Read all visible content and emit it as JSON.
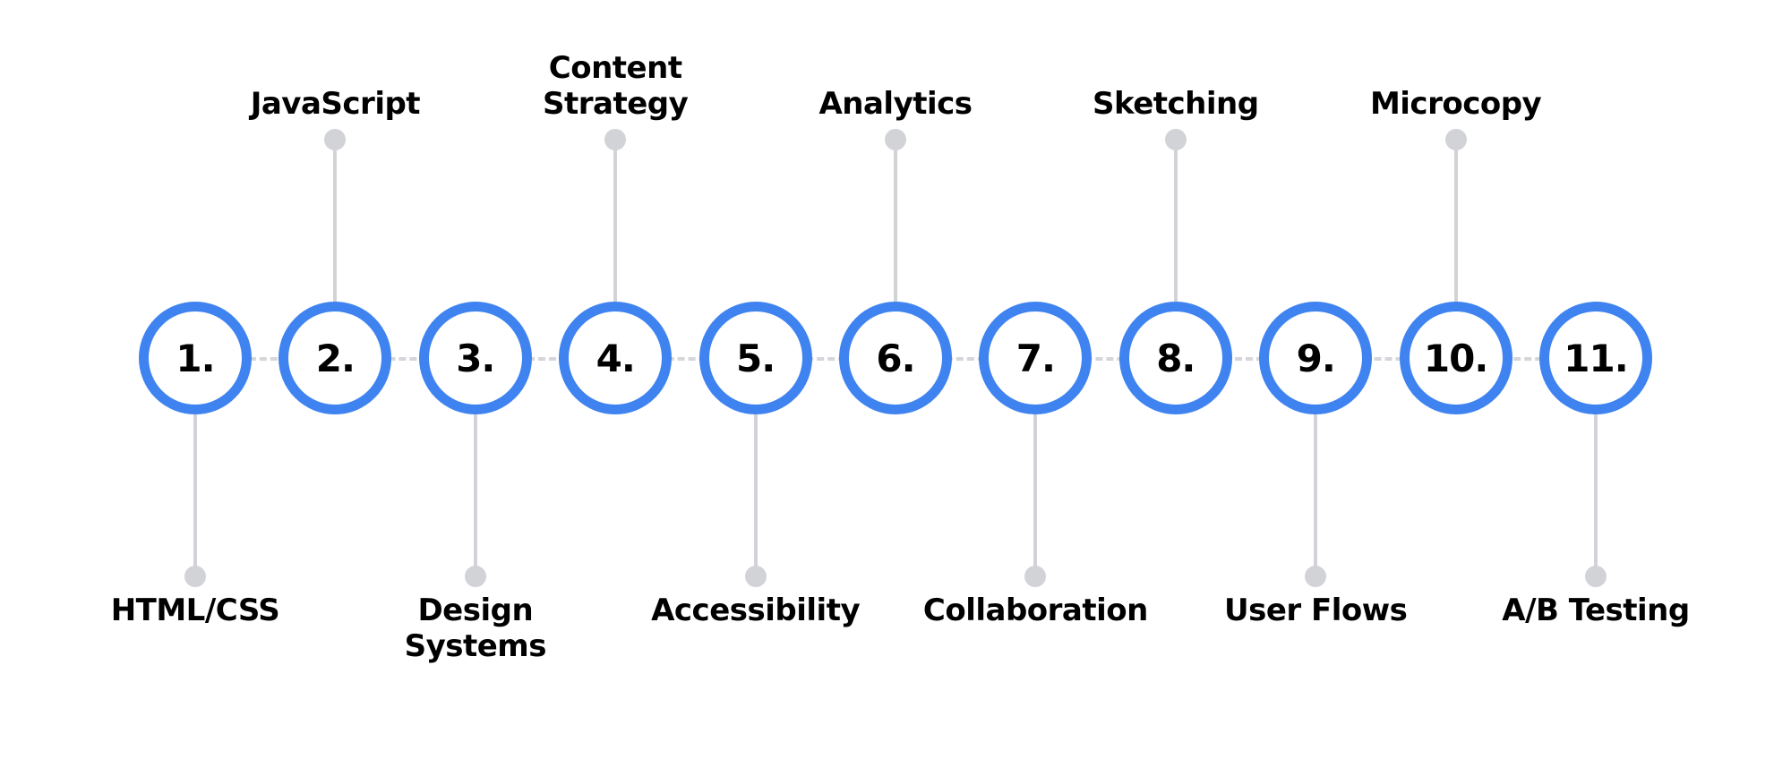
{
  "colors": {
    "ring": "#3f83f0",
    "connector": "#d1d3d7",
    "text": "#000000"
  },
  "steps": [
    {
      "number": "1.",
      "label": "HTML/CSS",
      "side": "bottom"
    },
    {
      "number": "2.",
      "label": "JavaScript",
      "side": "top"
    },
    {
      "number": "3.",
      "label": "Design\nSystems",
      "side": "bottom"
    },
    {
      "number": "4.",
      "label": "Content\nStrategy",
      "side": "top"
    },
    {
      "number": "5.",
      "label": "Accessibility",
      "side": "bottom"
    },
    {
      "number": "6.",
      "label": "Analytics",
      "side": "top"
    },
    {
      "number": "7.",
      "label": "Collaboration",
      "side": "bottom"
    },
    {
      "number": "8.",
      "label": "Sketching",
      "side": "top"
    },
    {
      "number": "9.",
      "label": "User Flows",
      "side": "bottom"
    },
    {
      "number": "10.",
      "label": "Microcopy",
      "side": "top"
    },
    {
      "number": "11.",
      "label": "A/B Testing",
      "side": "bottom"
    }
  ]
}
